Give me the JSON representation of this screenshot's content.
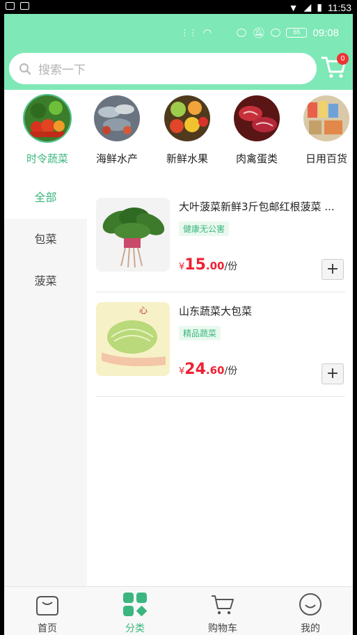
{
  "system": {
    "time": "11:53"
  },
  "status": {
    "time": "09:08",
    "battery": "65"
  },
  "search": {
    "placeholder": "搜索一下"
  },
  "cart": {
    "badge": "0"
  },
  "categories": [
    {
      "label": "时令蔬菜",
      "active": true
    },
    {
      "label": "海鲜水产",
      "active": false
    },
    {
      "label": "新鲜水果",
      "active": false
    },
    {
      "label": "肉禽蛋类",
      "active": false
    },
    {
      "label": "日用百货",
      "active": false
    }
  ],
  "sidebar": {
    "items": [
      "全部",
      "包菜",
      "菠菜"
    ]
  },
  "products": [
    {
      "name": "大叶菠菜新鲜3斤包邮红根菠菜 ...",
      "tag": "健康无公害",
      "currency": "¥",
      "price_int": "15",
      "price_dec": ".00",
      "unit": "/份",
      "add": "+"
    },
    {
      "name": "山东蔬菜大包菜",
      "tag": "精品蔬菜",
      "currency": "¥",
      "price_int": "24",
      "price_dec": ".60",
      "unit": "/份",
      "add": "+"
    }
  ],
  "tabbar": {
    "items": [
      "首页",
      "分类",
      "购物车",
      "我的"
    ]
  },
  "colors": {
    "accent": "#3bb67e",
    "header": "#7ee8b7",
    "price": "#e22233"
  }
}
